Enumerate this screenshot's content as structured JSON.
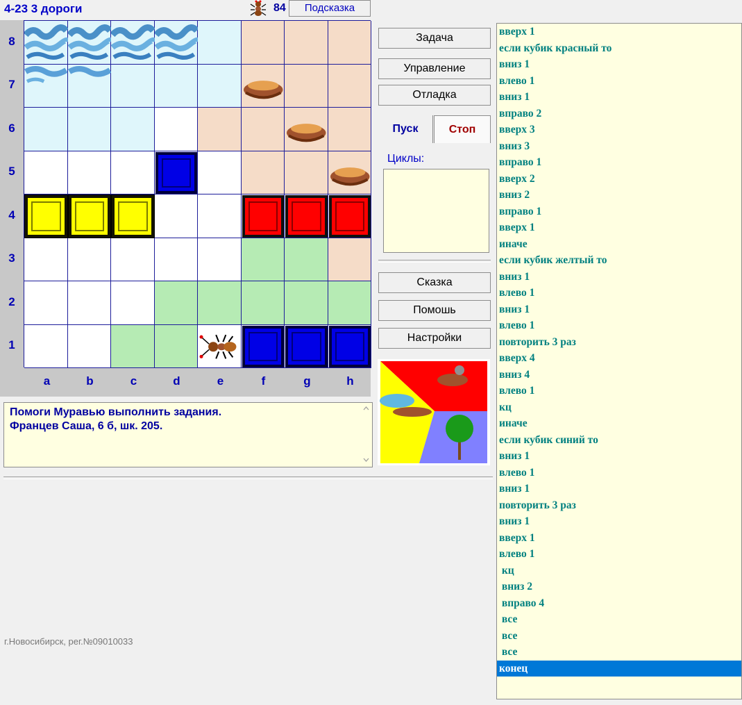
{
  "header": {
    "title": "4-23 3 дороги",
    "score": "84",
    "hint_label": "Подсказка"
  },
  "board": {
    "row_labels": [
      "8",
      "7",
      "6",
      "5",
      "4",
      "3",
      "2",
      "1"
    ],
    "col_labels": [
      "a",
      "b",
      "c",
      "d",
      "e",
      "f",
      "g",
      "h"
    ],
    "colors": {
      "water_zone": "#dff6fb",
      "nest_zone": "#f5dcc8",
      "grass_zone": "#b6ebb4",
      "empty": "#ffffff"
    }
  },
  "message": {
    "line1": "Помоги Муравью выполнить задания.",
    "line2": "Францев Саша, 6 б, шк. 205."
  },
  "footer": "г.Новосибирск, рег.№09010033",
  "controls": {
    "task": "Задача",
    "control": "Управление",
    "debug": "Отладка",
    "run": "Пуск",
    "stop": "Стоп",
    "cycles_label": "Циклы:",
    "story": "Сказка",
    "help": "Помошь",
    "settings": "Настройки"
  },
  "program": [
    "вверх 1",
    "если кубик красный то",
    "вниз 1",
    "влево 1",
    "вниз 1",
    "вправо 2",
    "вверх 3",
    "вниз 3",
    "вправо 1",
    "вверх 2",
    "вниз 2",
    "вправо 1",
    "вверх 1",
    "иначе",
    "если кубик желтый то",
    "вниз 1",
    "влево 1",
    "вниз 1",
    "влево 1",
    "повторить 3 раз",
    "вверх 4",
    "вниз 4",
    "влево 1",
    "кц",
    "иначе",
    "если кубик синий то",
    "вниз 1",
    "влево 1",
    "вниз 1",
    "повторить 3 раз",
    "вниз 1",
    "вверх 1",
    "влево 1",
    " кц",
    " вниз 2",
    " вправо 4",
    " все",
    " все",
    " все",
    "конец"
  ],
  "program_selected_index": 39
}
